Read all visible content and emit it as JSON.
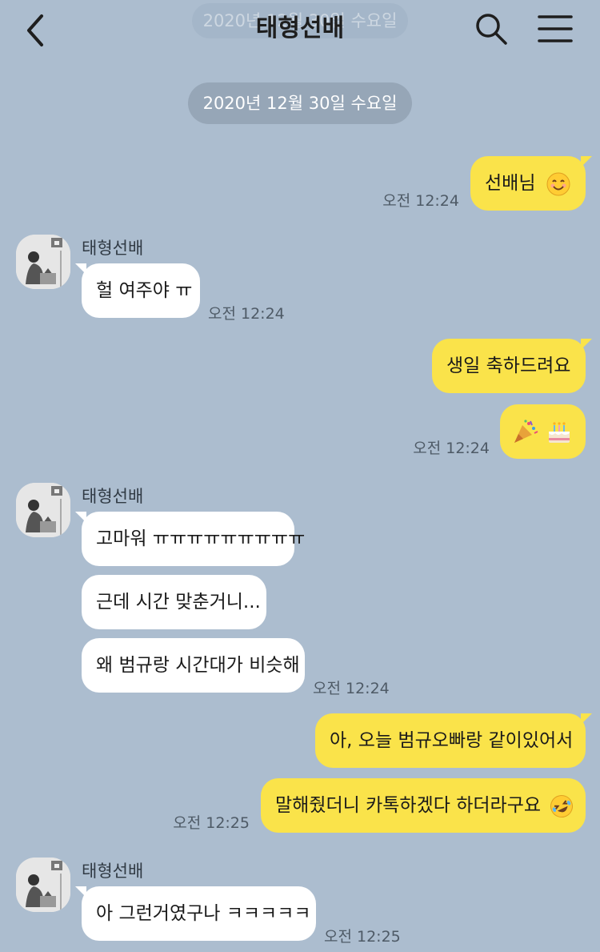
{
  "header": {
    "title": "태형선배",
    "ghost_date": "2020년 12월 30일 수요일"
  },
  "date_divider": "2020년 12월 30일 수요일",
  "colors": {
    "background": "#acbdcf",
    "my_bubble": "#fae34a",
    "their_bubble": "#ffffff"
  },
  "messages": {
    "m1": {
      "text": "선배님",
      "emoji": "smiling-face-emoji",
      "time": "오전 12:24"
    },
    "sender1": "태형선배",
    "m2": {
      "text": "헐 여주야 ㅠ",
      "time": "오전 12:24"
    },
    "m3": {
      "text": "생일 축하드려요"
    },
    "m4": {
      "emoji": "party-popper-cake-emoji",
      "time": "오전 12:24"
    },
    "sender2": "태형선배",
    "m5": {
      "text": "고마워 ㅠㅠㅠㅠㅠㅠㅠㅠㅠ"
    },
    "m6": {
      "text": "근데 시간 맞춘거니..."
    },
    "m7": {
      "text": "왜 범규랑 시간대가 비슷해",
      "time": "오전 12:24"
    },
    "m8": {
      "text": "아, 오늘 범규오빠랑 같이있어서"
    },
    "m9": {
      "text": "말해줬더니 카톡하겠다 하더라구요",
      "emoji": "rofl-face-emoji",
      "time": "오전 12:25"
    },
    "sender3": "태형선배",
    "m10": {
      "text": "아 그런거였구나 ㅋㅋㅋㅋㅋ",
      "time": "오전 12:25"
    }
  }
}
